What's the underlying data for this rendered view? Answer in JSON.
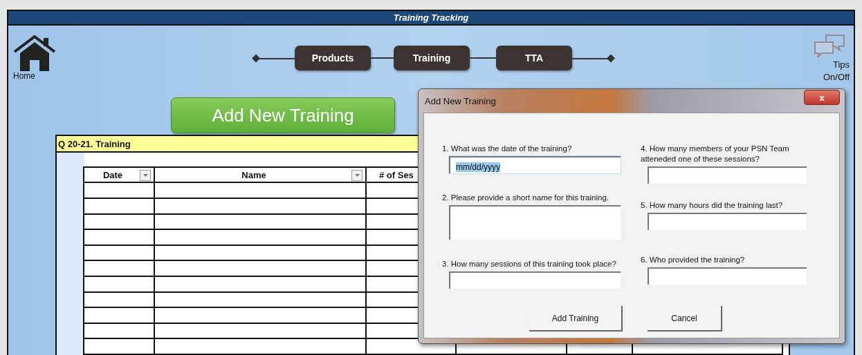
{
  "window": {
    "title": "Training Tracking"
  },
  "home": {
    "label": "Home"
  },
  "nav": [
    {
      "label": "Products",
      "selected": false
    },
    {
      "label": "Training",
      "selected": false
    },
    {
      "label": "TTA",
      "selected": false
    }
  ],
  "tips": {
    "label": "Tips On/Off"
  },
  "add_button": {
    "label": "Add New Training"
  },
  "section": {
    "title": "Q 20-21. Training"
  },
  "table": {
    "columns": [
      {
        "label": "Date",
        "filter": true
      },
      {
        "label": "Name",
        "filter": true
      },
      {
        "label": "# of Ses",
        "filter": false
      }
    ]
  },
  "dialog": {
    "title": "Add New Training",
    "close": "x",
    "fields": [
      {
        "label": "1. What was the date of the training?",
        "value": "mm/dd/yyyy",
        "highlighted": true,
        "kind": "single"
      },
      {
        "label": "2. Please provide a short name for this training.",
        "highlighted": false,
        "kind": "multiline"
      },
      {
        "label": "3. How many sessions of this training took place?",
        "highlighted": false,
        "kind": "single"
      },
      {
        "label": "4. How many members of your PSN Team atteneded one of these sessions?",
        "highlighted": false,
        "kind": "single"
      },
      {
        "label": "5. How many hours did the training last?",
        "highlighted": false,
        "kind": "single"
      },
      {
        "label": "6. Who provided the training?",
        "highlighted": false,
        "kind": "single"
      }
    ],
    "buttons": [
      "Add Training",
      "Cancel"
    ]
  }
}
